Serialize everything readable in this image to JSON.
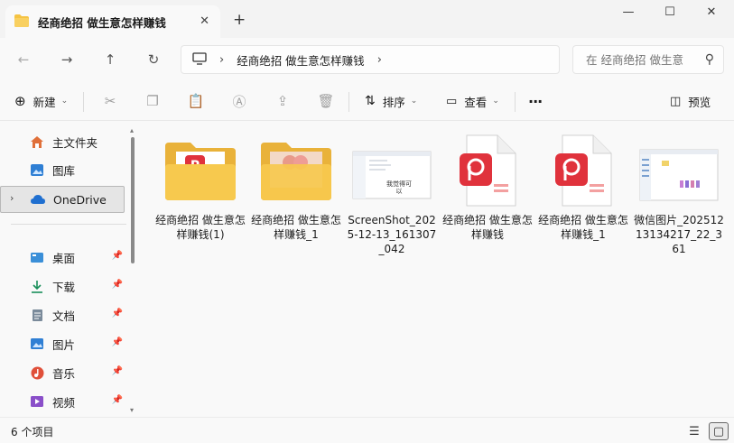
{
  "window": {
    "tab_title": "经商绝招 做生意怎样赚钱",
    "tab_close": "✕",
    "new_tab": "+",
    "minimize": "—",
    "maximize": "☐",
    "close": "✕"
  },
  "nav": {
    "back": "←",
    "forward": "→",
    "up": "↑",
    "refresh": "↻",
    "breadcrumb": [
      "经商绝招 做生意怎样赚钱"
    ],
    "search_placeholder": "在 经商绝招 做生意"
  },
  "commands": {
    "new_label": "新建",
    "sort_label": "排序",
    "view_label": "查看",
    "more": "···",
    "preview_label": "预览"
  },
  "sidebar": {
    "items": [
      {
        "label": "主文件夹",
        "icon": "home-icon",
        "color": "#e0703a"
      },
      {
        "label": "图库",
        "icon": "gallery-icon",
        "color": "#2f7fd4"
      },
      {
        "label": "OneDrive",
        "icon": "cloud-icon",
        "color": "#1f6fd0",
        "selected": true
      },
      {
        "label": "桌面",
        "icon": "desktop-icon",
        "color": "#3a8fd8",
        "pinned": true
      },
      {
        "label": "下载",
        "icon": "download-icon",
        "color": "#1a8f5a",
        "pinned": true
      },
      {
        "label": "文档",
        "icon": "document-icon",
        "color": "#667788",
        "pinned": true
      },
      {
        "label": "图片",
        "icon": "picture-icon",
        "color": "#2f7fd4",
        "pinned": true
      },
      {
        "label": "音乐",
        "icon": "music-icon",
        "color": "#e0503a",
        "pinned": true
      },
      {
        "label": "视频",
        "icon": "video-icon",
        "color": "#8a4fc9",
        "pinned": true
      }
    ]
  },
  "files": [
    {
      "name": "经商绝招 做生意怎样赚钱(1)",
      "type": "folder-wps"
    },
    {
      "name": "经商绝招 做生意怎样赚钱_1",
      "type": "folder-image"
    },
    {
      "name": "ScreenShot_2025-12-13_161307_042",
      "type": "screenshot",
      "thumb_text": "我觉得可以"
    },
    {
      "name": "经商绝招 做生意怎样赚钱",
      "type": "pdf"
    },
    {
      "name": "经商绝招 做生意怎样赚钱_1",
      "type": "pdf"
    },
    {
      "name": "微信图片_20251213134217_22_361",
      "type": "image"
    }
  ],
  "status": {
    "count": "6 个项目"
  },
  "colors": {
    "folder": "#f5c342",
    "pdf_red": "#e0323c",
    "accent": "#1f6fd0"
  }
}
